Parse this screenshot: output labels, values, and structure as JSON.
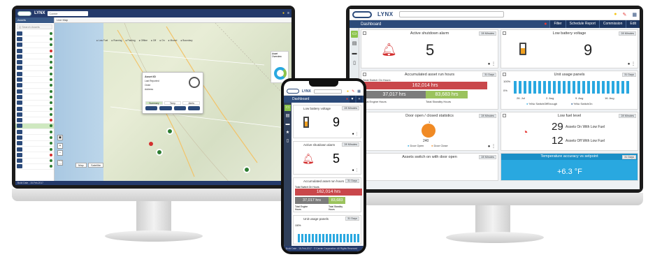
{
  "left_app": {
    "brand": "LYNX",
    "header_select": "Carrier",
    "toolbar_title": "Live Map",
    "sidebar_header": "Assets",
    "sidebar_search_placeholder": "Q  Search Assets",
    "filters": [
      "Low Fuel",
      "Running",
      "Parking",
      "Offline",
      "Off",
      "On",
      "Moved",
      "Boundary"
    ],
    "popup": {
      "title": "Asset ID",
      "line1": "Last Reported",
      "line2": "Order",
      "line3": "Address",
      "tabs": [
        "Summary",
        "Temp",
        "Alerts"
      ]
    },
    "map_buttons": [
      "Map",
      "Satellite"
    ],
    "status_title": "Asset Overview",
    "footer_text": "Build Date  -  15-Feb-2017"
  },
  "right_app": {
    "brand": "LYNX",
    "header_select": "",
    "page_title": "Dashboard",
    "toolbar_buttons": [
      "Filter",
      "Schedule Report",
      "Commission",
      "Edit"
    ],
    "cards": [
      {
        "title": "Active shutdown alarm",
        "badge": "28 Minutes",
        "value": "5"
      },
      {
        "title": "Low battery voltage",
        "badge": "28 Minutes",
        "value": "9"
      },
      {
        "title": "Accumulated asset run hours",
        "badge": "31 Days",
        "top_label": "Total Switch On Hours",
        "top_value": "162,014 hrs",
        "left_value": "37,017 hrs",
        "right_value": "83,683 hrs",
        "left_label": "Total Engine Hours",
        "right_label": "Total Standby Hours"
      },
      {
        "title": "Unit usage panels",
        "badge": "31 Days",
        "y_top": "100%",
        "y_mid": "0%",
        "xticks": [
          "26. Jul",
          "2. Aug",
          "9. Aug",
          "16. Aug"
        ],
        "legend": [
          "%No SwitchOffEnough",
          "%No SwitchOn"
        ]
      },
      {
        "title": "Door open / closed statistics",
        "badge": "28 Minutes",
        "count_top": "1",
        "count_bottom": "240",
        "legend": [
          "Door Open",
          "Door Close"
        ]
      },
      {
        "title": "Low fuel level",
        "badge": "28 Minutes",
        "line1_value": "29",
        "line1_text": "Assets On With Low Fuel",
        "line2_value": "12",
        "line2_text": "Assets Off With Low Fuel"
      },
      {
        "title": "Assets switch on with door open",
        "badge": "28 Minutes"
      },
      {
        "title": "Temperature accuracy vs setpoint",
        "badge": "31 Days",
        "value": "+6.3 °F"
      }
    ]
  },
  "phone_app": {
    "brand": "LYNX",
    "page_title": "Dashboard",
    "cards": [
      {
        "title": "Low battery voltage",
        "badge": "28 Minutes",
        "value": "9"
      },
      {
        "title": "Active shutdown alarm",
        "badge": "28 Minutes",
        "value": "5"
      },
      {
        "title": "Accumulated asset run hours",
        "badge": "31 Days",
        "top_label": "Total Switch On Hours",
        "top_value": "162,014 hrs",
        "left_value": "37,017 hrs",
        "right_value": "83,683",
        "left_label": "Total Engine Hours",
        "right_label": "Total Standby Hours"
      },
      {
        "title": "Unit usage panels",
        "badge": "31 Days",
        "y_top": "100%"
      }
    ],
    "footer_text": "Build Date  -  15-Feb-2017  ·  © Carrier Corporation. All Rights Reserved"
  },
  "colors": {
    "navy": "#2b4a7a",
    "green": "#8bc34a",
    "red": "#c9474b",
    "gray": "#7c7c7c",
    "olive": "#9bc35d",
    "cyan": "#29a8e0",
    "orange": "#f08a24"
  }
}
